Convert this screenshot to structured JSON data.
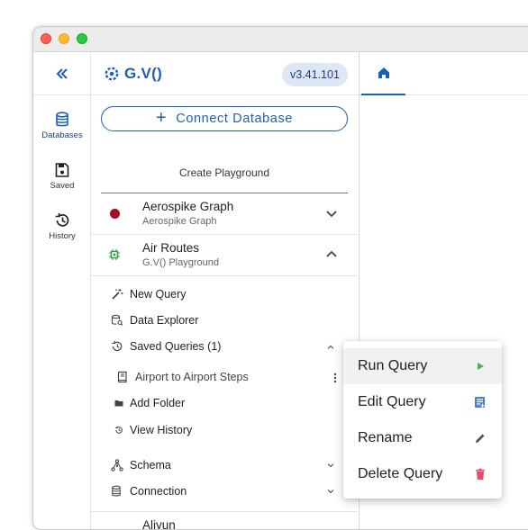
{
  "app": {
    "logo_text": "G.V()",
    "version": "v3.41.101"
  },
  "rail": {
    "items": [
      {
        "label": "Databases",
        "icon": "database-icon"
      },
      {
        "label": "Saved",
        "icon": "floppy-disk-icon"
      },
      {
        "label": "History",
        "icon": "history-icon"
      }
    ]
  },
  "sidebar": {
    "connect_label": "Connect Database",
    "playground_label": "Create Playground",
    "connections": [
      {
        "title": "Aerospike Graph",
        "subtitle": "Aerospike Graph",
        "status_color": "#a10f22",
        "expanded": false
      },
      {
        "title": "Air Routes",
        "subtitle": "G.V() Playground",
        "status_color": "#2a9d3a",
        "expanded": true
      },
      {
        "title": "Aliyun",
        "subtitle": "",
        "status_color": "#a10f22",
        "expanded": false
      }
    ],
    "tree": {
      "new_query": "New Query",
      "data_explorer": "Data Explorer",
      "saved_queries": "Saved Queries (1)",
      "saved_query_item": "Airport to Airport Steps",
      "add_folder": "Add Folder",
      "view_history": "View History",
      "schema": "Schema",
      "connection": "Connection"
    }
  },
  "context_menu": {
    "items": [
      {
        "label": "Run Query",
        "icon": "play-icon",
        "color": "#4caf50"
      },
      {
        "label": "Edit Query",
        "icon": "edit-query-icon",
        "color": "#4a7fc9"
      },
      {
        "label": "Rename",
        "icon": "pencil-icon",
        "color": "#555555"
      },
      {
        "label": "Delete Query",
        "icon": "trash-icon",
        "color": "#e0506a"
      }
    ]
  },
  "colors": {
    "accent": "#1d5fb8",
    "status_red": "#a10f22"
  }
}
